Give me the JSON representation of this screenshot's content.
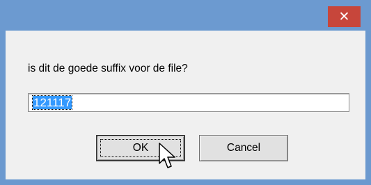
{
  "window": {
    "close_icon": "close-icon"
  },
  "dialog": {
    "prompt": "is dit de goede suffix voor de file?",
    "input_value": "121117",
    "ok_label": "OK",
    "cancel_label": "Cancel"
  },
  "colors": {
    "titlebar": "#6c9ad0",
    "close_button": "#c7463b",
    "client_bg": "#f0f0f0",
    "selection": "#3399ff"
  }
}
